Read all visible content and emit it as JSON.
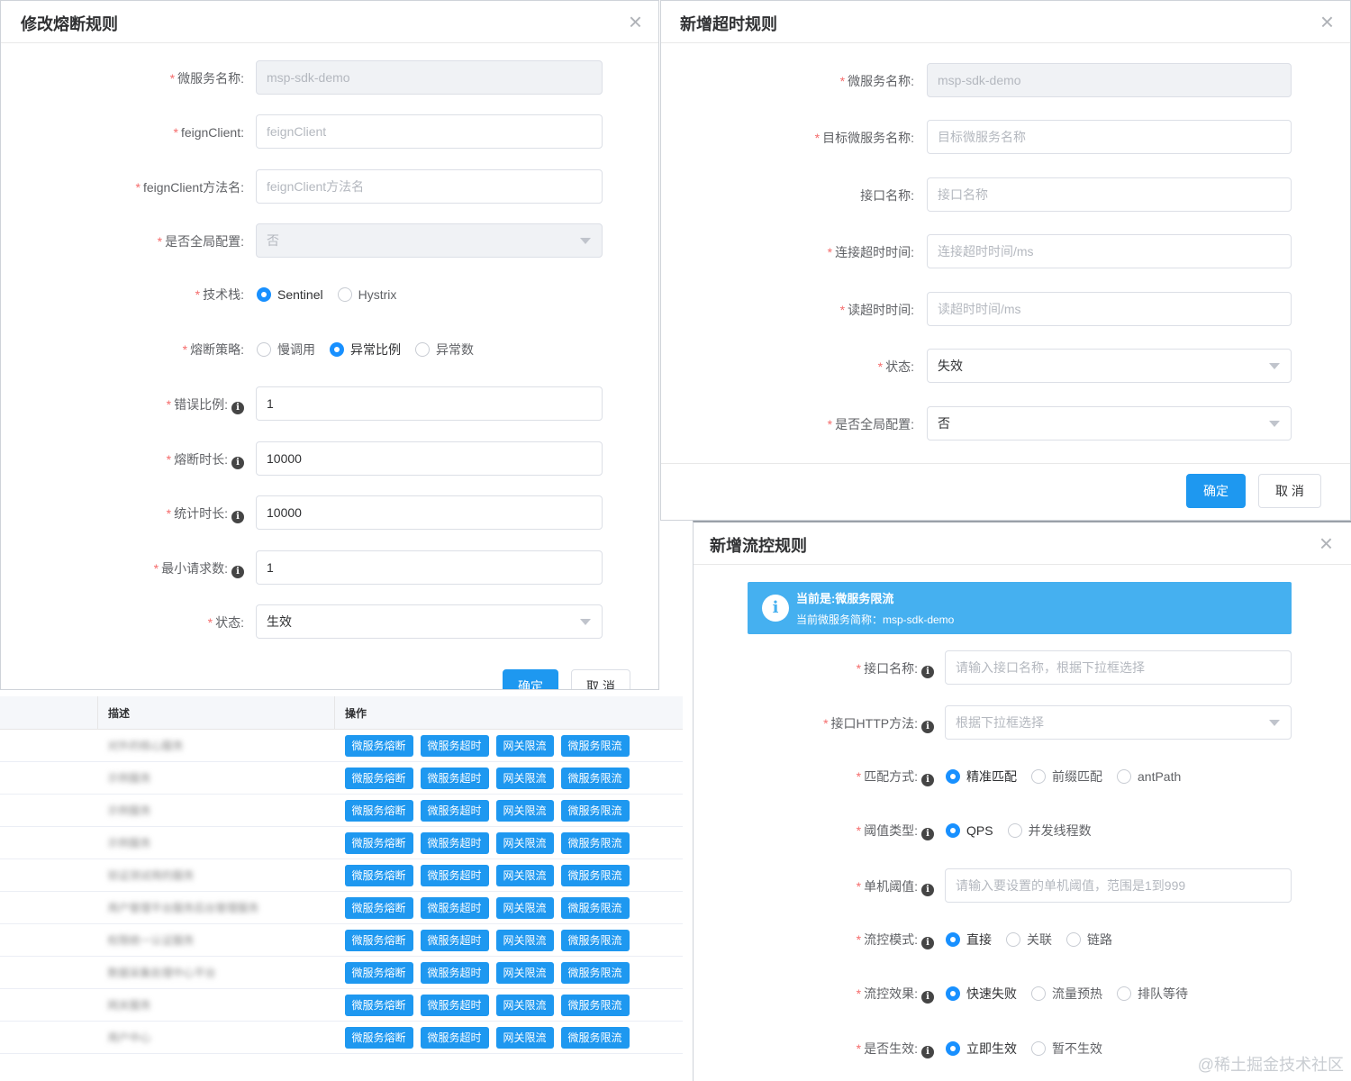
{
  "colors": {
    "primary": "#1e98f0",
    "required": "#f56c6c",
    "alert_bg": "#45b0f0",
    "border": "#dcdfe6"
  },
  "circuit_dialog": {
    "title": "修改熔断规则",
    "close_icon": "close-icon",
    "fields": {
      "service_name": {
        "label": "微服务名称:",
        "value": "msp-sdk-demo"
      },
      "feign_client": {
        "label": "feignClient:",
        "placeholder": "feignClient"
      },
      "feign_method": {
        "label": "feignClient方法名:",
        "placeholder": "feignClient方法名"
      },
      "global_config": {
        "label": "是否全局配置:",
        "value": "否"
      },
      "tech_stack": {
        "label": "技术栈:",
        "options": [
          "Sentinel",
          "Hystrix"
        ],
        "selected": "Sentinel"
      },
      "strategy": {
        "label": "熔断策略:",
        "options": [
          "慢调用",
          "异常比例",
          "异常数"
        ],
        "selected": "异常比例"
      },
      "error_ratio": {
        "label": "错误比例:",
        "value": "1"
      },
      "break_duration": {
        "label": "熔断时长:",
        "value": "10000"
      },
      "stat_duration": {
        "label": "统计时长:",
        "value": "10000"
      },
      "min_requests": {
        "label": "最小请求数:",
        "value": "1"
      },
      "status": {
        "label": "状态:",
        "value": "生效"
      }
    },
    "confirm_label": "确定",
    "cancel_label": "取 消"
  },
  "timeout_dialog": {
    "title": "新增超时规则",
    "close_icon": "close-icon",
    "fields": {
      "service_name": {
        "label": "微服务名称:",
        "value": "msp-sdk-demo"
      },
      "target_service": {
        "label": "目标微服务名称:",
        "placeholder": "目标微服务名称"
      },
      "api_name": {
        "label": "接口名称:",
        "placeholder": "接口名称"
      },
      "connect_timeout": {
        "label": "连接超时时间:",
        "placeholder": "连接超时时间/ms"
      },
      "read_timeout": {
        "label": "读超时时间:",
        "placeholder": "读超时时间/ms"
      },
      "status": {
        "label": "状态:",
        "value": "失效"
      },
      "global_config": {
        "label": "是否全局配置:",
        "value": "否"
      }
    },
    "confirm_label": "确定",
    "cancel_label": "取 消"
  },
  "flow_dialog": {
    "title": "新增流控规则",
    "close_icon": "close-icon",
    "alert": {
      "title": "当前是:微服务限流",
      "desc": "当前微服务简称：msp-sdk-demo"
    },
    "fields": {
      "api_name": {
        "label": "接口名称:",
        "placeholder": "请输入接口名称，根据下拉框选择"
      },
      "http_method": {
        "label": "接口HTTP方法:",
        "placeholder": "根据下拉框选择"
      },
      "match_mode": {
        "label": "匹配方式:",
        "options": [
          "精准匹配",
          "前缀匹配",
          "antPath"
        ],
        "selected": "精准匹配"
      },
      "threshold_type": {
        "label": "阈值类型:",
        "options": [
          "QPS",
          "并发线程数"
        ],
        "selected": "QPS"
      },
      "single_threshold": {
        "label": "单机阈值:",
        "placeholder": "请输入要设置的单机阈值，范围是1到999"
      },
      "flow_mode": {
        "label": "流控模式:",
        "options": [
          "直接",
          "关联",
          "链路"
        ],
        "selected": "直接"
      },
      "flow_effect": {
        "label": "流控效果:",
        "options": [
          "快速失败",
          "流量预热",
          "排队等待"
        ],
        "selected": "快速失败"
      },
      "enabled": {
        "label": "是否生效:",
        "options": [
          "立即生效",
          "暂不生效"
        ],
        "selected": "立即生效"
      }
    }
  },
  "table": {
    "columns": [
      "描述",
      "操作"
    ],
    "row_actions": [
      "微服务熔断",
      "微服务超时",
      "网关限流",
      "微服务限流"
    ],
    "rows": [
      {
        "desc": "对外的核心服务"
      },
      {
        "desc": "示例服务"
      },
      {
        "desc": "示例服务"
      },
      {
        "desc": "示例服务"
      },
      {
        "desc": "验证测试用的服务"
      },
      {
        "desc": "用户管理平台服务后台管理服务"
      },
      {
        "desc": "权限统一认证服务"
      },
      {
        "desc": "数据采集处理中心平台"
      },
      {
        "desc": "网关服务"
      },
      {
        "desc": "用户中心"
      }
    ]
  },
  "watermark": "@稀土掘金技术社区"
}
